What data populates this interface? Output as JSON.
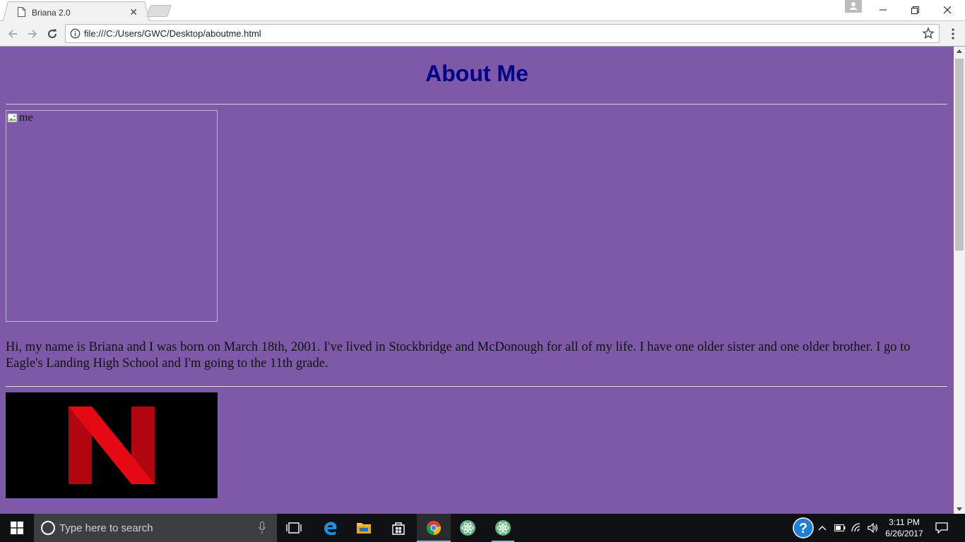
{
  "browser": {
    "tab_title": "Briana 2.0",
    "tab_close": "✕",
    "url": "file:///C:/Users/GWC/Desktop/aboutme.html"
  },
  "window_controls": {
    "minimize": "—",
    "restore": "❐",
    "close": "✕"
  },
  "page": {
    "background": "#7e59a8",
    "title": "About Me",
    "title_color": "#00008b",
    "profile_image_alt": "me",
    "bio": "Hi, my name is Briana and I was born on March 18th, 2001. I've lived in Stockbridge and McDonough for all of my life. I have one older sister and one older brother. I go to Eagle's Landing High School and I'm going to the 11th grade."
  },
  "taskbar": {
    "search_placeholder": "Type here to search",
    "apps": [
      "task-view",
      "edge",
      "file-explorer",
      "store",
      "chrome",
      "atom",
      "atom"
    ],
    "clock_time": "3:11 PM",
    "clock_date": "6/26/2017",
    "accent": "#76b9ed"
  }
}
